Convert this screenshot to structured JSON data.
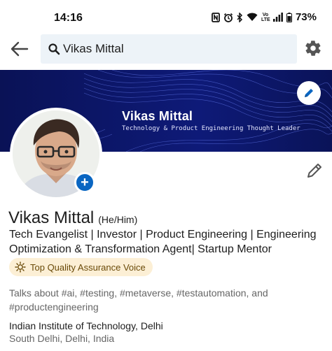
{
  "status_bar": {
    "time": "14:16",
    "icons": [
      "nfc-icon",
      "alarm-icon",
      "bluetooth-icon",
      "wifi-icon",
      "volte-icon",
      "signal-icon",
      "battery-icon"
    ],
    "volte": "Vo LTE",
    "battery": "73%"
  },
  "search": {
    "query": "Vikas Mittal"
  },
  "banner": {
    "name": "Vikas Mittal",
    "tagline": "Technology & Product Engineering Thought Leader",
    "background": "#0b1463"
  },
  "profile": {
    "name": "Vikas Mittal",
    "pronouns": "(He/Him)",
    "headline": "Tech Evangelist | Investor | Product Engineering | Engineering Optimization & Transformation Agent| Startup Mentor",
    "badge": "Top Quality Assurance Voice",
    "talks_about": "Talks about #ai, #testing, #metaverse, #testautomation, and #productengineering",
    "education": "Indian Institute of Technology, Delhi",
    "location": "South Delhi, Delhi, India"
  },
  "colors": {
    "accent": "#0a66c2",
    "search_bg": "#edf3f8",
    "badge_bg": "#fcefd5"
  }
}
